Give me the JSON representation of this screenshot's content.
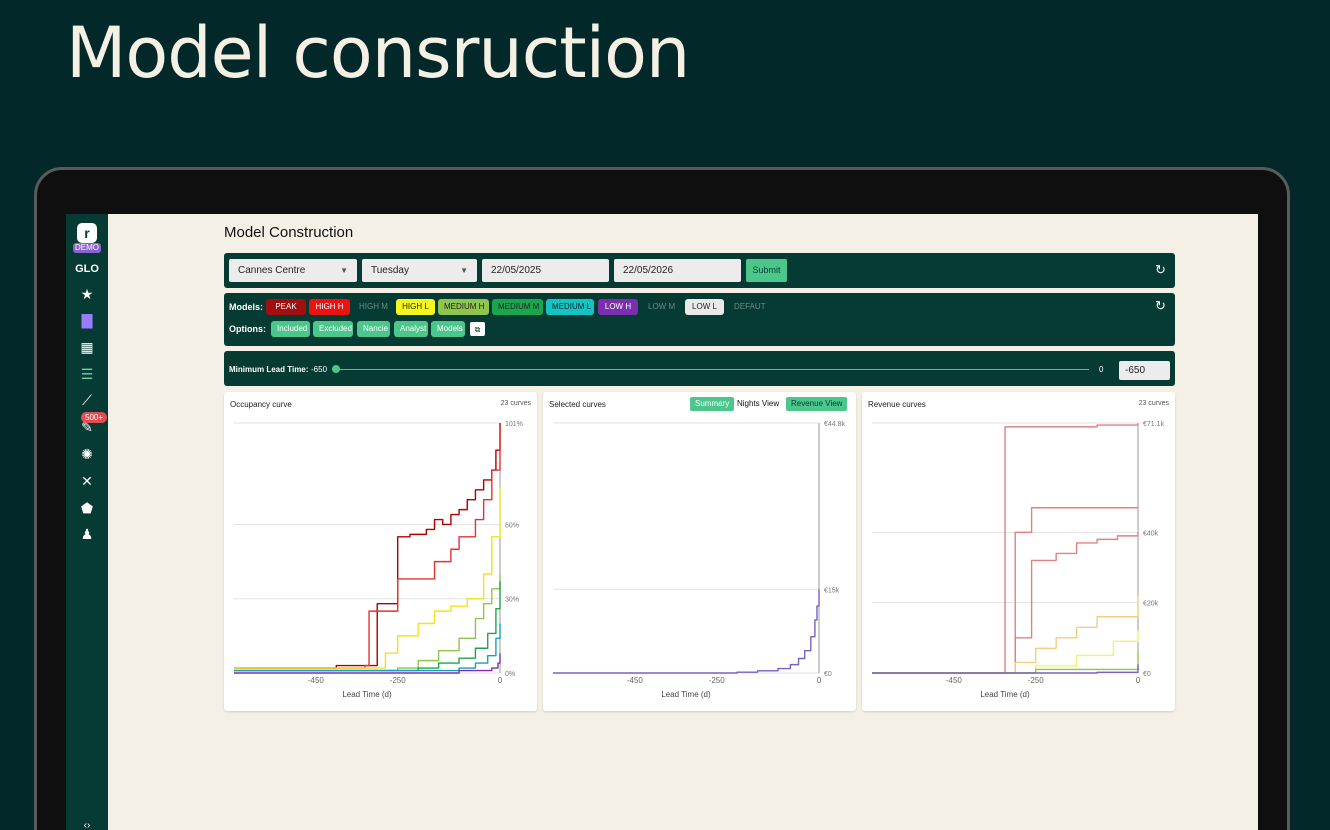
{
  "hero_title": "Model consruction",
  "sidebar": {
    "logo": "r",
    "demo_badge": "DEMO",
    "workspace": "GLO",
    "icons": [
      "star-icon",
      "pricing-icon",
      "dashboard-add-icon",
      "sliders-icon",
      "chart-search-icon",
      "tools-icon",
      "settings-icon",
      "hammer-icon",
      "security-icon",
      "user-settings-icon"
    ],
    "notification_count": "500+"
  },
  "page": {
    "title": "Model Construction"
  },
  "filters": {
    "hotel": "Cannes Centre",
    "day": "Tuesday",
    "date_from": "22/05/2025",
    "date_to": "22/05/2026",
    "submit_label": "Submit"
  },
  "models": {
    "label": "Models:",
    "chips": [
      "PEAK",
      "HIGH H",
      "HIGH M",
      "HIGH L",
      "MEDIUM H",
      "MEDIUM M",
      "MEDIUM L",
      "LOW H",
      "LOW M",
      "LOW L",
      "DEFAUT"
    ],
    "colors": {
      "PEAK": "#a30f0f",
      "HIGH H": "#ee1111",
      "HIGH L": "#f6f61f",
      "MEDIUM H": "#8fc54d",
      "MEDIUM M": "#1aa64c",
      "MEDIUM L": "#14c4c4",
      "LOW H": "#7a2eb0",
      "LOW L": "#e9e9e9"
    }
  },
  "options": {
    "label": "Options:",
    "chips": [
      "Included",
      "Excluded",
      "Nancie",
      "Analyst",
      "Models"
    ]
  },
  "lead_time": {
    "label": "Minimum Lead Time:",
    "min_label": "-650",
    "max_label": "0",
    "value": "-650"
  },
  "panels": {
    "occupancy": {
      "title": "Occupancy curve",
      "count": "23 curves",
      "xlabel": "Lead Time (d)"
    },
    "selected": {
      "title": "Selected curves",
      "summary": "Summary",
      "nights_view": "Nights View",
      "revenue_view": "Revenue View",
      "xlabel": "Lead Time (d)"
    },
    "revenue": {
      "title": "Revenue curves",
      "count": "23 curves",
      "xlabel": "Lead Time (d)"
    }
  },
  "chart_data": [
    {
      "type": "line",
      "title": "Occupancy curve",
      "xlabel": "Lead Time (d)",
      "ylabel": "",
      "x_ticks": [
        "-450",
        "-250",
        "0"
      ],
      "y_ticks": [
        "0%",
        "30%",
        "60%",
        "101%"
      ],
      "xlim": [
        -650,
        0
      ],
      "ylim": [
        0,
        101
      ],
      "series": [
        {
          "color": "#b00000",
          "x": [
            -650,
            -400,
            -350,
            -330,
            -310,
            -300,
            -260,
            -250,
            -220,
            -200,
            -180,
            -160,
            -140,
            -120,
            -100,
            -80,
            -60,
            -40,
            -20,
            -10,
            0
          ],
          "y": [
            2,
            3,
            3,
            3,
            3,
            28,
            28,
            55,
            56,
            56,
            58,
            62,
            60,
            64,
            66,
            70,
            74,
            78,
            82,
            90,
            101
          ]
        },
        {
          "color": "#e53030",
          "x": [
            -650,
            -330,
            -320,
            -250,
            -200,
            -160,
            -120,
            -100,
            -60,
            -40,
            -20,
            0
          ],
          "y": [
            2,
            3,
            25,
            38,
            38,
            45,
            50,
            55,
            62,
            70,
            82,
            100
          ]
        },
        {
          "color": "#f3e21a",
          "x": [
            -650,
            -300,
            -280,
            -250,
            -200,
            -160,
            -120,
            -80,
            -40,
            -20,
            0
          ],
          "y": [
            2,
            2,
            8,
            15,
            20,
            25,
            27,
            30,
            40,
            55,
            75
          ]
        },
        {
          "color": "#8fc54d",
          "x": [
            -650,
            -250,
            -200,
            -150,
            -100,
            -60,
            -40,
            -20,
            0
          ],
          "y": [
            1,
            2,
            5,
            9,
            14,
            22,
            28,
            34,
            40
          ]
        },
        {
          "color": "#1aa64c",
          "x": [
            -650,
            -200,
            -150,
            -100,
            -60,
            -30,
            -10,
            0
          ],
          "y": [
            1,
            2,
            4,
            6,
            10,
            16,
            26,
            37
          ]
        },
        {
          "color": "#14a0c4",
          "x": [
            -650,
            -150,
            -100,
            -60,
            -30,
            -10,
            0
          ],
          "y": [
            1,
            1,
            2,
            4,
            7,
            14,
            20
          ]
        },
        {
          "color": "#7a2eb0",
          "x": [
            -650,
            -100,
            -50,
            -20,
            -5,
            0
          ],
          "y": [
            0,
            1,
            1,
            2,
            4,
            8
          ]
        }
      ]
    },
    {
      "type": "line",
      "title": "Selected curves",
      "xlabel": "Lead Time (d)",
      "ylabel": "",
      "x_ticks": [
        "-450",
        "-250",
        "0"
      ],
      "y_ticks": [
        "€0",
        "€15k",
        "€44.8k"
      ],
      "xlim": [
        -650,
        0
      ],
      "ylim": [
        0,
        44800
      ],
      "series": [
        {
          "color": "#7a60c0",
          "x": [
            -650,
            -200,
            -150,
            -100,
            -70,
            -50,
            -35,
            -20,
            -10,
            -5,
            0
          ],
          "y": [
            0,
            150,
            400,
            800,
            1500,
            2600,
            4000,
            6500,
            9500,
            12000,
            15000
          ]
        }
      ]
    },
    {
      "type": "line",
      "title": "Revenue curves",
      "xlabel": "Lead Time (d)",
      "ylabel": "",
      "x_ticks": [
        "-450",
        "-250",
        "0"
      ],
      "y_ticks": [
        "€0",
        "€20k",
        "€40k",
        "€71.1k"
      ],
      "xlim": [
        -650,
        0
      ],
      "ylim": [
        0,
        71100
      ],
      "series": [
        {
          "color": "#e38080",
          "x": [
            -650,
            -330,
            -325,
            -200,
            -100,
            0
          ],
          "y": [
            0,
            0,
            70000,
            70000,
            70500,
            71100
          ]
        },
        {
          "color": "#e38080",
          "x": [
            -650,
            -320,
            -300,
            -260,
            -200,
            -100,
            0
          ],
          "y": [
            0,
            0,
            40000,
            47000,
            47000,
            47000,
            47000
          ]
        },
        {
          "color": "#e38080",
          "x": [
            -650,
            -300,
            -260,
            -200,
            -150,
            -100,
            -50,
            0
          ],
          "y": [
            0,
            10000,
            32000,
            34000,
            37000,
            38000,
            39000,
            40000
          ]
        },
        {
          "color": "#f0d080",
          "x": [
            -650,
            -300,
            -250,
            -200,
            -150,
            -100,
            0
          ],
          "y": [
            0,
            3000,
            7000,
            10000,
            13000,
            16000,
            22000
          ]
        },
        {
          "color": "#f6f06a",
          "x": [
            -650,
            -250,
            -150,
            -60,
            0
          ],
          "y": [
            0,
            2000,
            5000,
            9000,
            12000
          ]
        },
        {
          "color": "#8fc54d",
          "x": [
            -650,
            -250,
            0
          ],
          "y": [
            0,
            1000,
            6000
          ]
        },
        {
          "color": "#7a60c0",
          "x": [
            -650,
            -100,
            0
          ],
          "y": [
            0,
            200,
            2500
          ]
        }
      ]
    }
  ]
}
